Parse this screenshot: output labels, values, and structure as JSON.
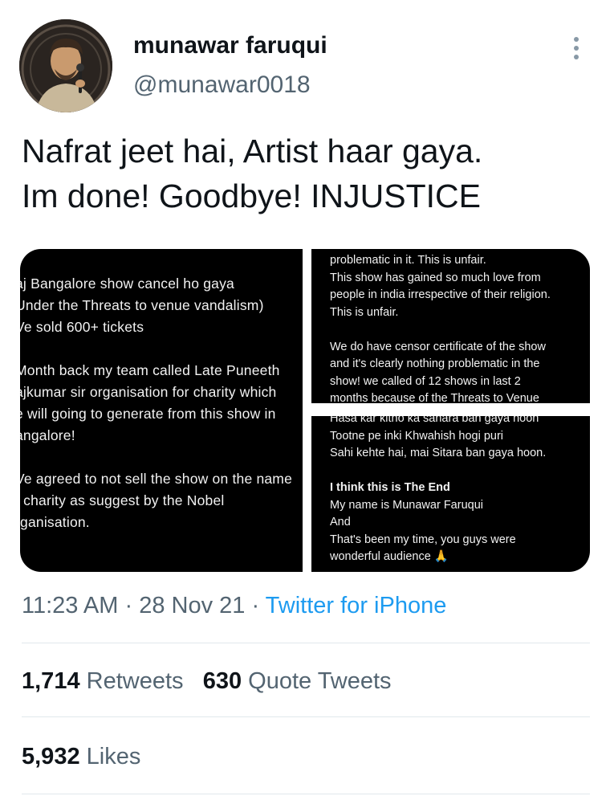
{
  "tweet": {
    "author_name": "munawar faruqui",
    "author_handle": "@munawar0018",
    "text_lines": [
      "Nafrat jeet hai, Artist haar gaya.",
      "Im done! Goodbye! INJUSTICE"
    ],
    "time": "11:23 AM",
    "date": "28 Nov 21",
    "separator": "·",
    "source": "Twitter for iPhone"
  },
  "images": {
    "left_lines": [
      "aj Bangalore show cancel ho gaya",
      "Under the Threats to venue vandalism)",
      "Ve sold 600+ tickets",
      "",
      "Month back my team called Late Puneeth",
      "ajkumar sir organisation for charity which",
      "e will going to generate from this show in",
      "angalore!",
      "",
      "Ve agreed to not sell the show on the name",
      "f charity as suggest by the Nobel",
      "rganisation."
    ],
    "top_right_lines": [
      "problematic in it. This is unfair.",
      "This show has gained so much love from",
      "people in india irrespective of their religion.",
      "This is unfair.",
      "",
      "We do have censor certificate of the show",
      "and it's clearly nothing problematic in the",
      "show! we called of 12 shows in last 2",
      "months because of the Threats to Venue"
    ],
    "bottom_right_lines": [
      "Hasa kar kitno ka sahara ban gaya hoon",
      "Tootne pe inki Khwahish hogi puri",
      "Sahi kehte hai, mai Sitara ban gaya hoon.",
      "",
      "I think this is The End",
      "My name is Munawar Faruqui",
      "And",
      "That's been my time, you guys were",
      "wonderful audience 🙏"
    ]
  },
  "stats": {
    "retweets_count": "1,714",
    "retweets_label": "Retweets",
    "quotes_count": "630",
    "quotes_label": "Quote Tweets",
    "likes_count": "5,932",
    "likes_label": "Likes"
  },
  "colors": {
    "text": "#0f1419",
    "secondary": "#536471",
    "link": "#1d9bf0",
    "divider": "#e1e8ed"
  },
  "icons": {
    "more": "more-vertical-icon"
  }
}
